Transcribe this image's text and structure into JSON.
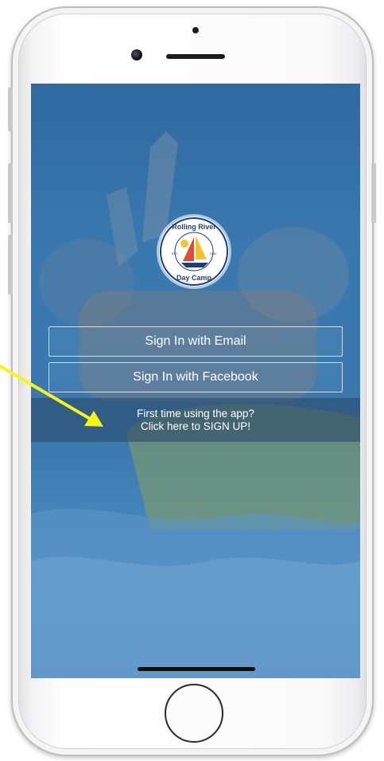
{
  "app": {
    "logo_text_top": "Rolling River",
    "logo_text_bottom": "Day Camp",
    "logo_est": "EST.",
    "logo_year": "1992"
  },
  "auth": {
    "email_label": "Sign In with Email",
    "facebook_label": "Sign In with Facebook"
  },
  "signup": {
    "line1": "First time using the app?",
    "line2": "Click here to SIGN UP!"
  },
  "annotation": {
    "arrow_color": "#f5f51a"
  },
  "colors": {
    "screen_tint": "#3a79b0",
    "banner": "#2b4a68"
  }
}
